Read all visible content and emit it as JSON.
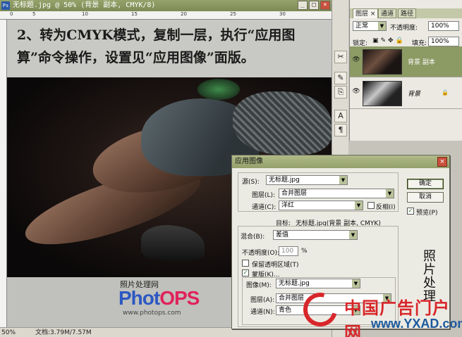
{
  "doc_window": {
    "ps_icon": "Ps",
    "title": "无标题.jpg @ 50% (背景 副本, CMYK/8)",
    "ruler_marks": [
      "0",
      "5",
      "10",
      "15",
      "20",
      "25",
      "30"
    ],
    "zoom": "50%",
    "status": "文档:3.79M/7.57M"
  },
  "instruction": {
    "line1": "2、转为CMYK模式，复制一层，执行“应用图",
    "line2": "算”命令操作，设置见“应用图像”面版。"
  },
  "logo": {
    "sub": "照片处理网",
    "main_a": "Phot",
    "main_b": "OPS",
    "url": "www.photops.com"
  },
  "tools": [
    "✂",
    "✎",
    "⎘",
    "A",
    "¶"
  ],
  "layers_panel": {
    "tabs": [
      "图层 ×",
      "通道",
      "路径"
    ],
    "blend_mode": "正常",
    "opacity_label": "不透明度:",
    "opacity_value": "100%",
    "lock_label": "锁定:",
    "fill_label": "填充:",
    "fill_value": "100%",
    "layers": [
      {
        "name": "背景 副本",
        "selected": true
      },
      {
        "name": "背景",
        "selected": false
      }
    ]
  },
  "apply_image_dialog": {
    "title": "应用图像",
    "source_label": "源(S):",
    "source_value": "无标题.jpg",
    "layer_label": "图层(L):",
    "layer_value": "合并图层",
    "channel_label": "通道(C):",
    "channel_value": "洋红",
    "invert_label": "反相(I)",
    "target_label": "目标:",
    "target_value": "无标题.jpg(背景 副本, CMYK)",
    "blending_label": "混合(B):",
    "blending_value": "差值",
    "opacity_label": "不透明度(O):",
    "opacity_value": "100",
    "opacity_unit": "%",
    "preserve_label": "保留透明区域(T)",
    "mask_label": "蒙版(K)...",
    "mask_image_label": "图像(M):",
    "mask_image_value": "无标题.jpg",
    "mask_layer_label": "图层(A):",
    "mask_layer_value": "合并图层",
    "mask_channel_label": "通道(N):",
    "mask_channel_value": "青色",
    "ok": "确定",
    "cancel": "取消",
    "preview_label": "预览(P)"
  },
  "watermark": {
    "calligraphy": "照片处理",
    "cn": "中国广告门户网",
    "url": "www.YXAD.com"
  }
}
